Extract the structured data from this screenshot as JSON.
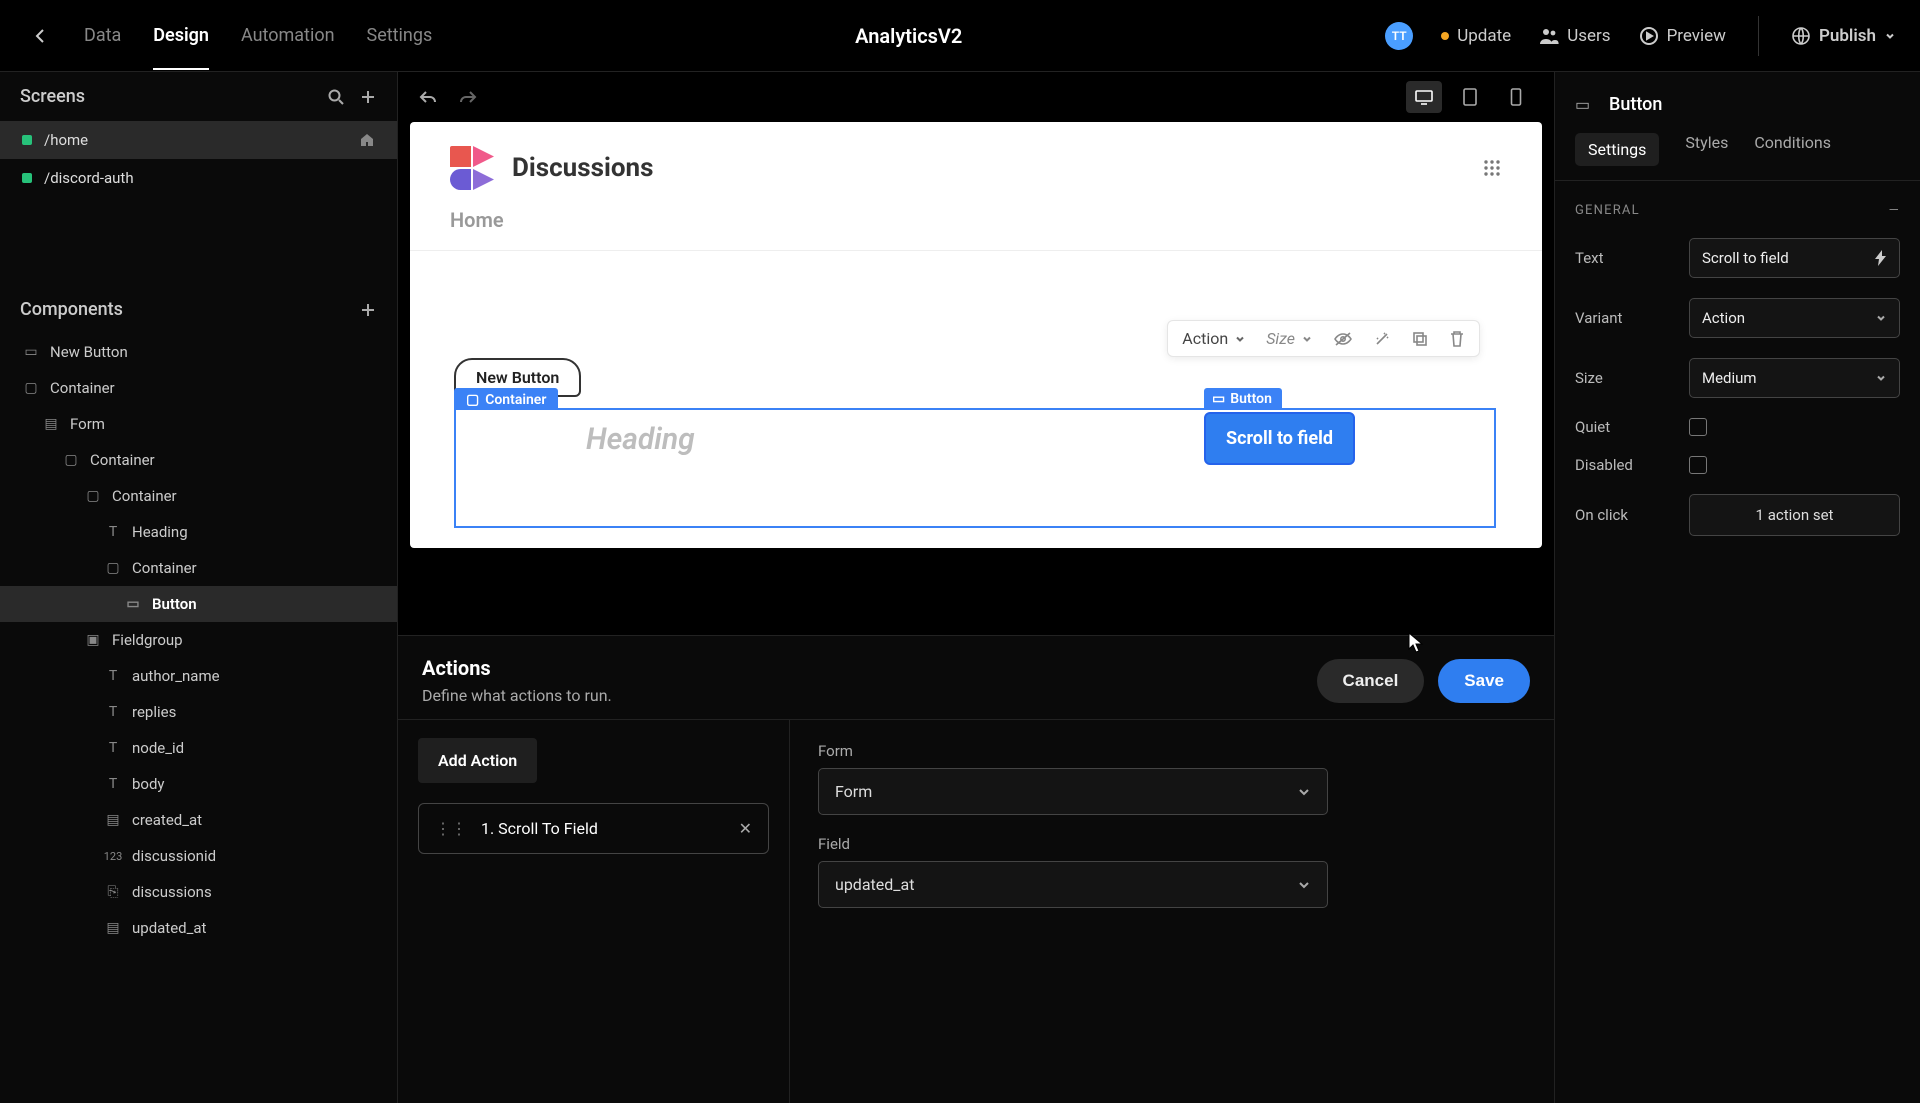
{
  "topbar": {
    "tabs": {
      "data": "Data",
      "design": "Design",
      "automation": "Automation",
      "settings": "Settings"
    },
    "app_title": "AnalyticsV2",
    "avatar_initials": "TT",
    "update": "Update",
    "users": "Users",
    "preview": "Preview",
    "publish": "Publish"
  },
  "left": {
    "screens_title": "Screens",
    "screens": {
      "home": "/home",
      "discord": "/discord-auth"
    },
    "components_title": "Components",
    "tree": {
      "new_button": "New Button",
      "container1": "Container",
      "form": "Form",
      "container2": "Container",
      "container3": "Container",
      "heading": "Heading",
      "container4": "Container",
      "button": "Button",
      "fieldgroup": "Fieldgroup",
      "author_name": "author_name",
      "replies": "replies",
      "node_id": "node_id",
      "body": "body",
      "created_at": "created_at",
      "discussionid": "discussionid",
      "discussions": "discussions",
      "updated_at": "updated_at"
    }
  },
  "canvas": {
    "brand_title": "Discussions",
    "crumb": "Home",
    "float": {
      "action": "Action",
      "size": "Size"
    },
    "new_button": "New Button",
    "container_tag": "Container",
    "heading_ph": "Heading",
    "button_tag": "Button",
    "scroll_btn": "Scroll to field"
  },
  "actions": {
    "title": "Actions",
    "subtitle": "Define what actions to run.",
    "cancel": "Cancel",
    "save": "Save",
    "add_action": "Add Action",
    "item1": "1. Scroll To Field",
    "form_label": "Form",
    "form_value": "Form",
    "field_label": "Field",
    "field_value": "updated_at"
  },
  "right": {
    "type": "Button",
    "tabs": {
      "settings": "Settings",
      "styles": "Styles",
      "conditions": "Conditions"
    },
    "section": "GENERAL",
    "props": {
      "text_label": "Text",
      "text_value": "Scroll to field",
      "variant_label": "Variant",
      "variant_value": "Action",
      "size_label": "Size",
      "size_value": "Medium",
      "quiet_label": "Quiet",
      "disabled_label": "Disabled",
      "onclick_label": "On click",
      "onclick_value": "1 action set"
    }
  }
}
